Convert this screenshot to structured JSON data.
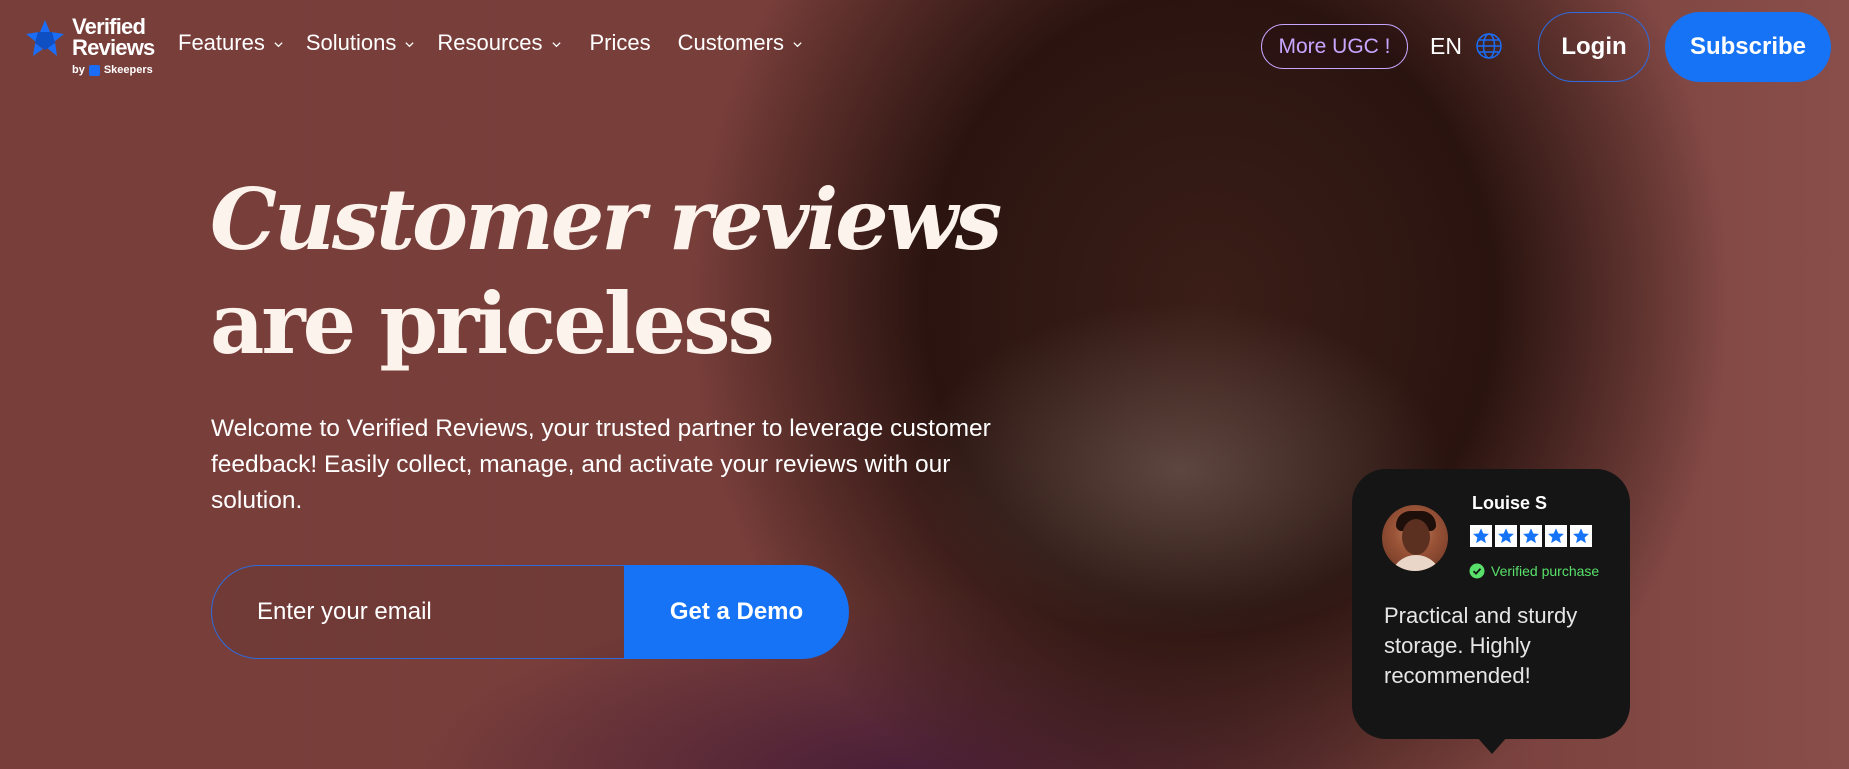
{
  "brand": {
    "name_line1": "Verified",
    "name_line2": "Reviews",
    "by": "by",
    "parent": "Skeepers"
  },
  "nav": {
    "items": [
      {
        "label": "Features",
        "dropdown": true
      },
      {
        "label": "Solutions",
        "dropdown": true
      },
      {
        "label": "Resources",
        "dropdown": true
      },
      {
        "label": "Prices",
        "dropdown": false
      },
      {
        "label": "Customers",
        "dropdown": true
      }
    ],
    "ugc_label": "More UGC !",
    "language": "EN",
    "login_label": "Login",
    "subscribe_label": "Subscribe"
  },
  "hero": {
    "headline_line1": "Customer reviews",
    "headline_line2": "are priceless",
    "intro": "Welcome to Verified Reviews, your trusted partner to leverage customer feedback! Easily collect, manage, and activate your reviews with our solution.",
    "email_placeholder": "Enter your email",
    "cta_label": "Get a Demo"
  },
  "review": {
    "name": "Louise S",
    "rating": 5,
    "rating_max": 5,
    "verified_label": "Verified purchase",
    "text": "Practical and sturdy storage. Highly recommended!"
  },
  "colors": {
    "accent_blue": "#1673f5",
    "ugc_purple": "#c7a6ff",
    "verified_green": "#58e06a",
    "card_bg": "#151515"
  },
  "icons": [
    "logo-mark-icon",
    "chevron-down-icon",
    "globe-icon",
    "star-icon",
    "check-circle-icon"
  ]
}
